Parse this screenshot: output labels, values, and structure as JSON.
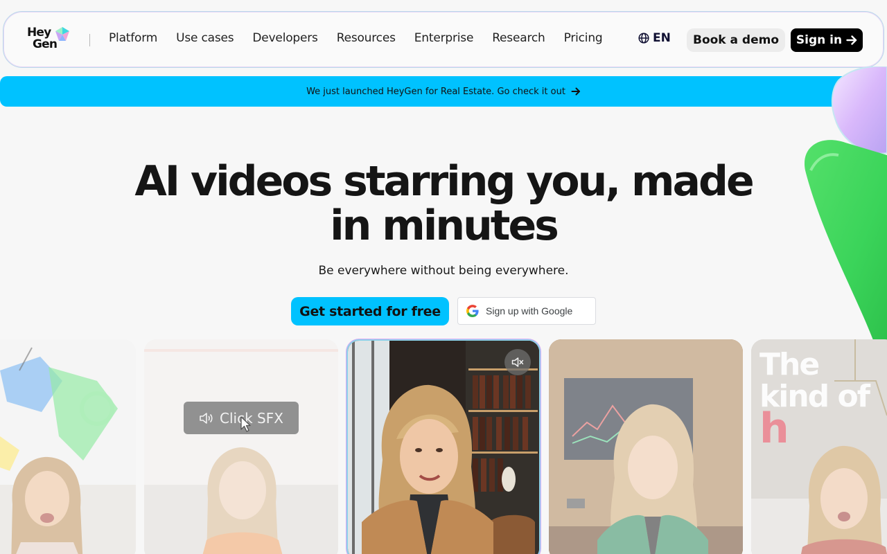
{
  "brand": {
    "line1": "Hey",
    "line2": "Gen"
  },
  "nav": {
    "links": [
      "Platform",
      "Use cases",
      "Developers",
      "Resources",
      "Enterprise",
      "Research",
      "Pricing"
    ],
    "lang": "EN",
    "demo_label": "Book a demo",
    "signin_label": "Sign in"
  },
  "banner": {
    "text": "We just launched HeyGen for Real Estate. Go check it out"
  },
  "hero": {
    "title_line1": "AI videos starring you, made",
    "title_line2": "in minutes",
    "subtitle": "Be everywhere without being everywhere.",
    "cta_primary": "Get started for free",
    "cta_google": "Sign up with Google"
  },
  "cards": {
    "sfx_label": "Click SFX",
    "overlay_line1": "The",
    "overlay_line2": "kind of",
    "overlay_line3": "h"
  },
  "colors": {
    "accent": "#00c2ff",
    "dark": "#111111"
  }
}
